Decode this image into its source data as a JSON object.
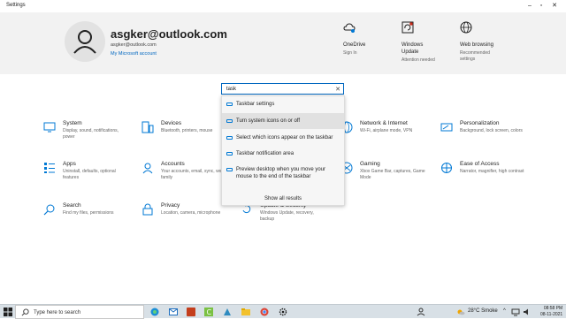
{
  "window": {
    "title": "Settings"
  },
  "account": {
    "email_big": "asgker@outlook.com",
    "email_small": "asgker@outlook.com",
    "link": "My Microsoft account"
  },
  "header_quick": [
    {
      "title": "OneDrive",
      "sub": "Sign In",
      "icon": "onedrive-icon"
    },
    {
      "title": "Windows Update",
      "sub": "Attention needed",
      "icon": "windows-update-icon"
    },
    {
      "title": "Web browsing",
      "sub": "Recommended settings",
      "icon": "globe-icon"
    }
  ],
  "search": {
    "value": "task",
    "suggestions": [
      "Taskbar settings",
      "Turn system icons on or off",
      "Select which icons appear on the taskbar",
      "Taskbar notification area",
      "Preview desktop when you move your mouse to the end of the taskbar"
    ],
    "show_all": "Show all results"
  },
  "categories": [
    {
      "title": "System",
      "sub": "Display, sound, notifications, power",
      "icon": "laptop-icon"
    },
    {
      "title": "Devices",
      "sub": "Bluetooth, printers, mouse",
      "icon": "devices-icon"
    },
    {
      "title": "Network & Internet",
      "sub": "Wi-Fi, airplane mode, VPN",
      "icon": "globe-icon"
    },
    {
      "title": "Personalization",
      "sub": "Background, lock screen, colors",
      "icon": "brush-icon"
    },
    {
      "title": "Apps",
      "sub": "Uninstall, defaults, optional features",
      "icon": "apps-icon"
    },
    {
      "title": "Accounts",
      "sub": "Your accounts, email, sync, work, family",
      "icon": "person-icon"
    },
    {
      "title": "Gaming",
      "sub": "Xbox Game Bar, captures, Game Mode",
      "icon": "xbox-icon"
    },
    {
      "title": "Ease of Access",
      "sub": "Narrator, magnifier, high contrast",
      "icon": "ease-of-access-icon"
    },
    {
      "title": "Search",
      "sub": "Find my files, permissions",
      "icon": "search-icon"
    },
    {
      "title": "Privacy",
      "sub": "Location, camera, microphone",
      "icon": "lock-icon"
    },
    {
      "title": "Update & Security",
      "sub": "Windows Update, recovery, backup",
      "icon": "refresh-icon"
    }
  ],
  "taskbar": {
    "search_placeholder": "Type here to search",
    "weather": "28°C  Smoke",
    "time": "08:58 PM",
    "date": "08-11-2021"
  },
  "colors": {
    "accent": "#0067c0",
    "header_bg": "#f2f2f2",
    "icon_blue": "#0078d4"
  }
}
